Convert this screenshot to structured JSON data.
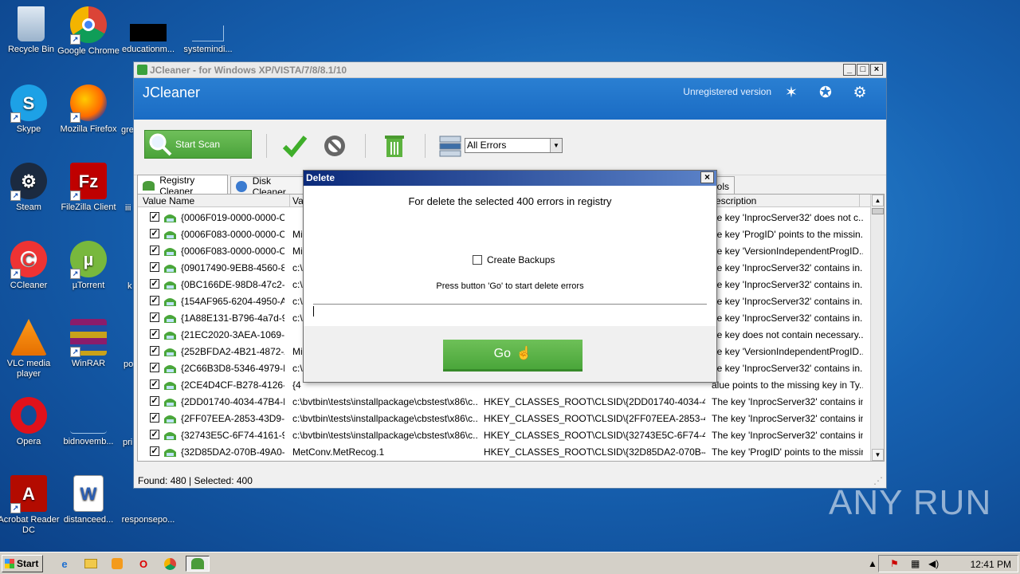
{
  "desktop": {
    "icons": [
      {
        "label": "Recycle Bin",
        "icon": "recycle-bin-icon"
      },
      {
        "label": "Google Chrome",
        "icon": "chrome-icon"
      },
      {
        "label": "educationm...",
        "icon": "file-icon"
      },
      {
        "label": "systemindi...",
        "icon": "file-icon"
      },
      {
        "label": "Skype",
        "icon": "skype-icon"
      },
      {
        "label": "Mozilla Firefox",
        "icon": "firefox-icon"
      },
      {
        "label": "Steam",
        "icon": "steam-icon"
      },
      {
        "label": "FileZilla Client",
        "icon": "filezilla-icon"
      },
      {
        "label": "CCleaner",
        "icon": "ccleaner-icon"
      },
      {
        "label": "µTorrent",
        "icon": "utorrent-icon"
      },
      {
        "label": "VLC media player",
        "icon": "vlc-icon"
      },
      {
        "label": "WinRAR",
        "icon": "winrar-icon"
      },
      {
        "label": "Opera",
        "icon": "opera-icon"
      },
      {
        "label": "bidnovemb...",
        "icon": "file-icon"
      },
      {
        "label": "Acrobat Reader DC",
        "icon": "acrobat-icon"
      },
      {
        "label": "distanceed...",
        "icon": "word-doc-icon"
      },
      {
        "label": "responsepo...",
        "icon": "file-icon"
      }
    ],
    "partial_labels": [
      "gre",
      "iii",
      "k",
      "po",
      "pri"
    ]
  },
  "window": {
    "title": "JCleaner - for Windows XP/VISTA/7/8/8.1/10",
    "app_name": "JCleaner",
    "unregistered": "Unregistered version",
    "start_scan": "Start Scan",
    "filter_value": "All Errors",
    "tabs": [
      "Registry Cleaner",
      "Disk Cleaner",
      "ools"
    ],
    "columns": [
      "Value Name",
      "Va",
      "escription"
    ],
    "rows": [
      {
        "name": "{0006F019-0000-0000-C0...",
        "value": "",
        "key": "",
        "desc": "he key 'InprocServer32' does not c..."
      },
      {
        "name": "{0006F083-0000-0000-C0...",
        "value": "Mi",
        "key": "",
        "desc": "he key 'ProgID' points to the missin..."
      },
      {
        "name": "{0006F083-0000-0000-C0...",
        "value": "Mi",
        "key": "",
        "desc": "he key 'VersionIndependentProgID..."
      },
      {
        "name": "{09017490-9EB8-4560-86...",
        "value": "c:\\",
        "key": "",
        "desc": "he key 'InprocServer32' contains in..."
      },
      {
        "name": "{0BC166DE-98D8-47c2-A...",
        "value": "c:\\",
        "key": "",
        "desc": "he key 'InprocServer32' contains in..."
      },
      {
        "name": "{154AF965-6204-4950-AF...",
        "value": "c:\\",
        "key": "",
        "desc": "he key 'InprocServer32' contains in..."
      },
      {
        "name": "{1A88E131-B796-4a7d-9...",
        "value": "c:\\",
        "key": "",
        "desc": "he key 'InprocServer32' contains in..."
      },
      {
        "name": "{21EC2020-3AEA-1069-A...",
        "value": "",
        "key": "",
        "desc": "he key does not contain necessary..."
      },
      {
        "name": "{252BFDA2-4B21-4872-A...",
        "value": "Mi",
        "key": "",
        "desc": "he key 'VersionIndependentProgID..."
      },
      {
        "name": "{2C66B3D8-5346-4979-B...",
        "value": "c:\\",
        "key": "",
        "desc": "he key 'InprocServer32' contains in..."
      },
      {
        "name": "{2CE4D4CF-B278-4126-A...",
        "value": "{4",
        "key": "",
        "desc": "alue points to the missing key in Ty..."
      },
      {
        "name": "{2DD01740-4034-47B4-B...",
        "value": "c:\\bvtbin\\tests\\installpackage\\cbstest\\x86\\c...",
        "key": "HKEY_CLASSES_ROOT\\CLSID\\{2DD01740-4034-47...",
        "desc": "The key 'InprocServer32' contains in..."
      },
      {
        "name": "{2FF07EEA-2853-43D9-B...",
        "value": "c:\\bvtbin\\tests\\installpackage\\cbstest\\x86\\c...",
        "key": "HKEY_CLASSES_ROOT\\CLSID\\{2FF07EEA-2853-43...",
        "desc": "The key 'InprocServer32' contains in..."
      },
      {
        "name": "{32743E5C-6F74-4161-9E...",
        "value": "c:\\bvtbin\\tests\\installpackage\\cbstest\\x86\\c...",
        "key": "HKEY_CLASSES_ROOT\\CLSID\\{32743E5C-6F74-416...",
        "desc": "The key 'InprocServer32' contains in..."
      },
      {
        "name": "{32D85DA2-070B-49A0-9...",
        "value": "MetConv.MetRecog.1",
        "key": "HKEY_CLASSES_ROOT\\CLSID\\{32D85DA2-070B-49...",
        "desc": "The key 'ProgID' points to the missin..."
      }
    ],
    "status": "Found: 480 | Selected: 400"
  },
  "dialog": {
    "title": "Delete",
    "close": "×",
    "message": "For delete the selected 400 errors in registry",
    "backup_label": "Create Backups",
    "hint": "Press button 'Go' to start delete errors",
    "go": "Go"
  },
  "taskbar": {
    "start": "Start",
    "clock": "12:41 PM"
  },
  "watermark": "ANY RUN"
}
